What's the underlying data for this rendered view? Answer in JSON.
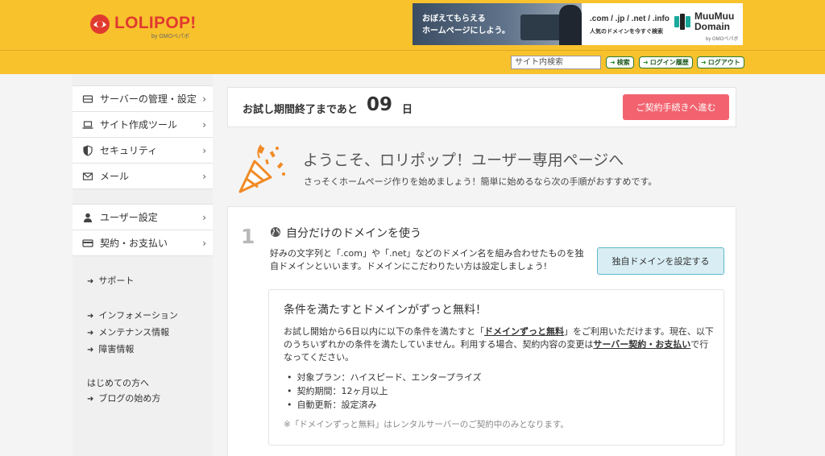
{
  "header": {
    "logo_text": "LOLIPOP!",
    "logo_sub": "by GMOペパボ",
    "banner": {
      "copy_line1": "おぼえてもらえる",
      "copy_line2": "ホームページにしよう。",
      "tlds": ".com / .jp / .net / .info",
      "tagline": "人気のドメインを今すぐ検索",
      "brand_line1": "MuuMuu",
      "brand_line2": "Domain",
      "brand_sub": "by GMOペパボ"
    },
    "search_placeholder": "サイト内検索",
    "links": [
      "検索",
      "ログイン履歴",
      "ログアウト"
    ]
  },
  "sidebar": {
    "main_items": [
      {
        "label": "サーバーの管理・設定",
        "icon": "server-icon"
      },
      {
        "label": "サイト作成ツール",
        "icon": "laptop-icon"
      },
      {
        "label": "セキュリティ",
        "icon": "shield-icon"
      },
      {
        "label": "メール",
        "icon": "mail-icon"
      }
    ],
    "account_items": [
      {
        "label": "ユーザー設定",
        "icon": "user-icon"
      },
      {
        "label": "契約・お支払い",
        "icon": "credit-card-icon"
      }
    ],
    "support": "サポート",
    "info_links": [
      "インフォメーション",
      "メンテナンス情報",
      "障害情報"
    ],
    "beginner_heading": "はじめての方へ",
    "beginner_link": "ブログの始め方"
  },
  "trial": {
    "label": "お試し期間終了まであと",
    "days": "09",
    "unit": "日",
    "button": "ご契約手続きへ進む"
  },
  "welcome": {
    "title": "ようこそ、ロリポップ！ユーザー専用ページへ",
    "subtitle": "さっそくホームページ作りを始めましょう！簡単に始めるなら次の手順がおすすめです。"
  },
  "step1": {
    "number": "1",
    "title": "自分だけのドメインを使う",
    "desc": "好みの文字列と「.com」や「.net」などのドメイン名を組み合わせたものを独自ドメインといいます。ドメインにこだわりたい方は設定しましょう!",
    "button": "独自ドメインを設定する",
    "condition": {
      "title": "条件を満たすとドメインがずっと無料！",
      "body_before": "お試し開始から6日以内に以下の条件を満たすと「",
      "body_link1": "ドメインずっと無料",
      "body_middle": "」をご利用いただけます。現在、以下のうちいずれかの条件を満たしていません。利用する場合、契約内容の変更は",
      "body_link2": "サーバー契約・お支払い",
      "body_after": "で行なってください。",
      "items": [
        "対象プラン：ハイスピード、エンタープライズ",
        "契約期間：12ヶ月以上",
        "自動更新：設定済み"
      ],
      "note": "※「ドメインずっと無料」はレンタルサーバーのご契約中のみとなります。"
    }
  },
  "colors": {
    "header_yellow": "#f8c22d",
    "contract_button": "#f2636f",
    "domain_button_bg": "#d9eef4",
    "logo_red": "#e03a2f"
  }
}
